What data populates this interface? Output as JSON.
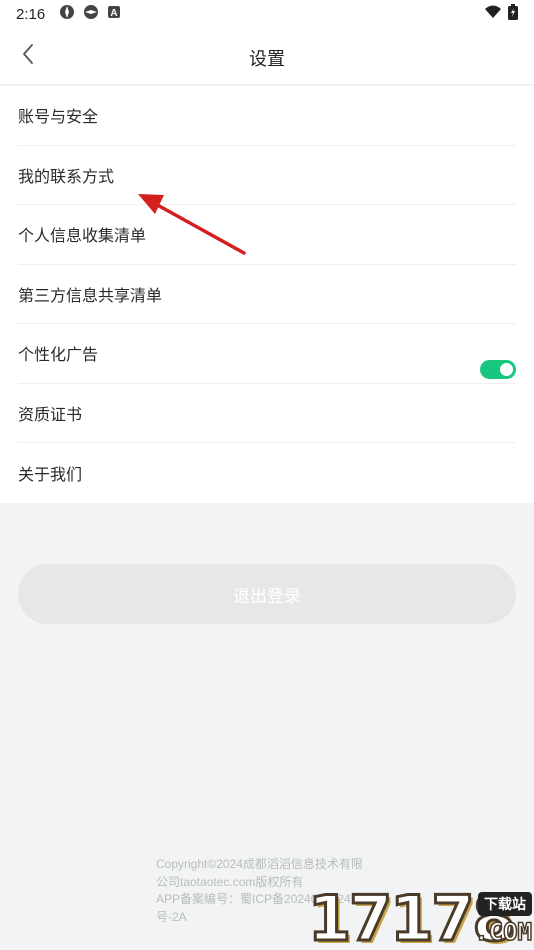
{
  "status_bar": {
    "time": "2:16",
    "left_icons": [
      "app-icon-1",
      "app-icon-2",
      "a-letter-icon"
    ],
    "right_icons": [
      "wifi-icon",
      "battery-charging-icon"
    ]
  },
  "header": {
    "title": "设置",
    "back_icon": "chevron-left-icon"
  },
  "menu": {
    "items": [
      {
        "label": "账号与安全"
      },
      {
        "label": "我的联系方式"
      },
      {
        "label": "个人信息收集清单"
      },
      {
        "label": "第三方信息共享清单"
      },
      {
        "label": "个性化广告",
        "toggle_on": true
      },
      {
        "label": "资质证书"
      },
      {
        "label": "关于我们"
      }
    ]
  },
  "logout_button": {
    "label": "退出登录"
  },
  "footer": {
    "line1": "Copyright©2024成都滔滔信息技术有限",
    "line2": "公司taotaotec.com版权所有",
    "line3": "APP备案编号：蜀ICP备2024036624",
    "line4": "号-2A"
  },
  "watermark": {
    "number": "17178",
    "badge": "下载站",
    "domain": ".COM"
  },
  "colors": {
    "toggle_on": "#17c77f",
    "annotation_arrow": "#d41f1f",
    "page_bg": "#f1f3f4",
    "logout_bg": "#e6e8e8"
  }
}
